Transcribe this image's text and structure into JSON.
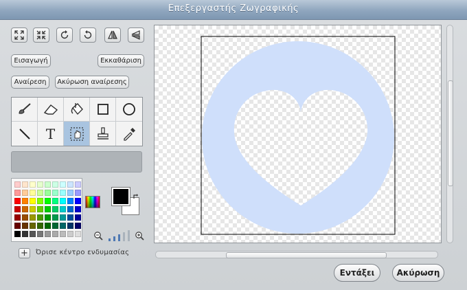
{
  "window": {
    "title": "Επεξεργαστής Ζωγραφικής"
  },
  "toolbar": {
    "icons": [
      "grow-icon",
      "shrink-icon",
      "rotate-right-icon",
      "rotate-left-icon",
      "flip-horizontal-icon",
      "flip-vertical-icon"
    ],
    "import_label": "Εισαγωγή",
    "clear_label": "Εκκαθάριση",
    "undo_label": "Αναίρεση",
    "redo_label": "Ακύρωση αναίρεσης"
  },
  "tools": [
    {
      "name": "paintbrush",
      "icon": "brush-icon",
      "selected": false
    },
    {
      "name": "eraser",
      "icon": "eraser-icon",
      "selected": false
    },
    {
      "name": "fill",
      "icon": "bucket-icon",
      "selected": false
    },
    {
      "name": "rectangle",
      "icon": "square-icon",
      "selected": false
    },
    {
      "name": "ellipse",
      "icon": "circle-icon",
      "selected": false
    },
    {
      "name": "line",
      "icon": "line-icon",
      "selected": false
    },
    {
      "name": "text",
      "icon": "text-icon",
      "selected": false
    },
    {
      "name": "select",
      "icon": "select-icon",
      "selected": true
    },
    {
      "name": "stamp",
      "icon": "stamp-icon",
      "selected": false
    },
    {
      "name": "eyedropper",
      "icon": "eyedropper-icon",
      "selected": false
    }
  ],
  "text_tool_glyph": "T",
  "colors": {
    "foreground": "#000000",
    "background": "#ffffff",
    "canvas_shape": "#cfdffb",
    "selected_tool_bg": "#a9c4e0",
    "palette": [
      [
        "#ffcccc",
        "#ffe5cc",
        "#ffffcc",
        "#e5ffcc",
        "#ccffcc",
        "#ccffe5",
        "#ccffff",
        "#cce5ff",
        "#ccccff",
        "#e5ccff",
        "#ffccff"
      ],
      [
        "#ff9999",
        "#ffcc99",
        "#ffff99",
        "#ccff99",
        "#99ff99",
        "#99ffcc",
        "#99ffff",
        "#99ccff",
        "#9999ff",
        "#cc99ff",
        "#ff99ff"
      ],
      [
        "#ff0000",
        "#ff8000",
        "#ffff00",
        "#80ff00",
        "#00ff00",
        "#00ff80",
        "#00ffff",
        "#0080ff",
        "#0000ff",
        "#8000ff",
        "#ff00ff"
      ],
      [
        "#cc0000",
        "#cc6600",
        "#cccc00",
        "#66cc00",
        "#00cc00",
        "#00cc66",
        "#00cccc",
        "#0066cc",
        "#0000cc",
        "#6600cc",
        "#cc00cc"
      ],
      [
        "#990000",
        "#994c00",
        "#999900",
        "#4c9900",
        "#009900",
        "#00994c",
        "#009999",
        "#004c99",
        "#000099",
        "#4c0099",
        "#990099"
      ],
      [
        "#660000",
        "#663300",
        "#666600",
        "#336600",
        "#006600",
        "#006633",
        "#006666",
        "#003366",
        "#000066",
        "#330066",
        "#660066"
      ],
      [
        "#000000",
        "#333333",
        "#555555",
        "#777777",
        "#999999",
        "#aaaaaa",
        "#bbbbbb",
        "#cccccc",
        "#dddddd",
        "#eeeeee",
        "#ffffff"
      ]
    ]
  },
  "zoom": {
    "out_icon": "zoom-out-icon",
    "in_icon": "zoom-in-icon",
    "level": 3
  },
  "set_center": {
    "plus_glyph": "+",
    "label": "Όρισε κέντρο ενδυμασίας"
  },
  "dialog": {
    "ok_label": "Εντάξει",
    "cancel_label": "Ακύρωση"
  }
}
